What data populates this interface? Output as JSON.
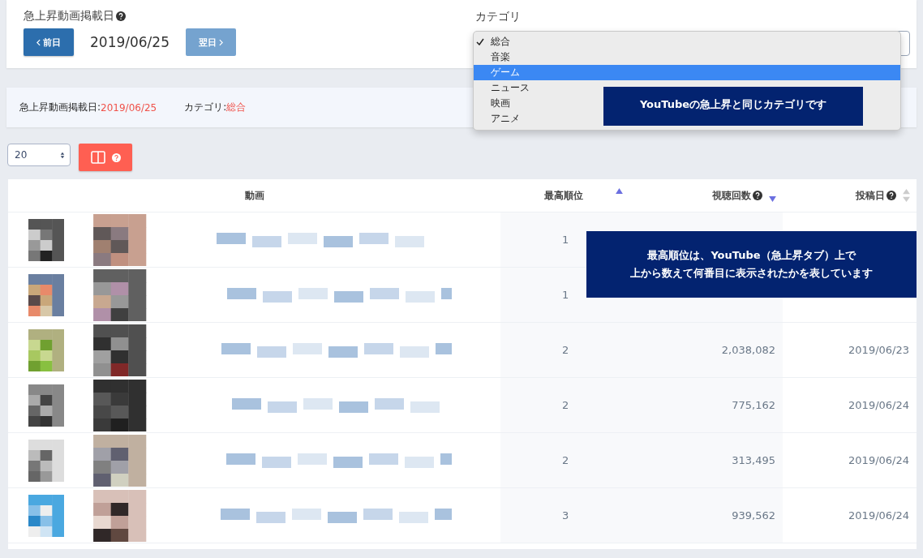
{
  "date_panel": {
    "label": "急上昇動画掲載日",
    "prev_button": {
      "label": "前日",
      "disabled": false
    },
    "date": "2019/06/25",
    "next_button": {
      "label": "翌日",
      "disabled": true
    }
  },
  "category": {
    "label": "カテゴリ",
    "options": [
      {
        "label": "総合",
        "checked": true,
        "highlighted": false
      },
      {
        "label": "音楽",
        "checked": false,
        "highlighted": false
      },
      {
        "label": "ゲーム",
        "checked": false,
        "highlighted": true
      },
      {
        "label": "ニュース",
        "checked": false,
        "highlighted": false
      },
      {
        "label": "映画",
        "checked": false,
        "highlighted": false
      },
      {
        "label": "アニメ",
        "checked": false,
        "highlighted": false
      }
    ],
    "tooltip": "YouTubeの急上昇と同じカテゴリです"
  },
  "summary": {
    "date_label": "急上昇動画掲載日:",
    "date": "2019/06/25",
    "category_label": "カテゴリ:",
    "category": "総合"
  },
  "page_size": "20",
  "table": {
    "columns": [
      {
        "label": "動画"
      },
      {
        "label": "最高順位",
        "help": false,
        "sorted_ascending": true,
        "sorted_descending": false
      },
      {
        "label": "視聴回数",
        "help": true,
        "sorted_ascending": false,
        "sorted_descending": true
      },
      {
        "label": "投稿日",
        "help": true,
        "sorted_ascending": false,
        "sorted_descending": false
      }
    ],
    "rows": [
      {
        "rank": "1"
      },
      {
        "rank": "1"
      },
      {
        "rank": "2",
        "views": "2,038,082",
        "date": "2019/06/23"
      },
      {
        "rank": "2",
        "views": "775,162",
        "date": "2019/06/24"
      },
      {
        "rank": "2",
        "views": "313,495",
        "date": "2019/06/24"
      },
      {
        "rank": "3",
        "views": "939,562",
        "date": "2019/06/24"
      }
    ],
    "tooltip": [
      "最高順位は、YouTube（急上昇タブ）上で",
      "上から数えて何番目に表示されたかを表しています"
    ]
  }
}
